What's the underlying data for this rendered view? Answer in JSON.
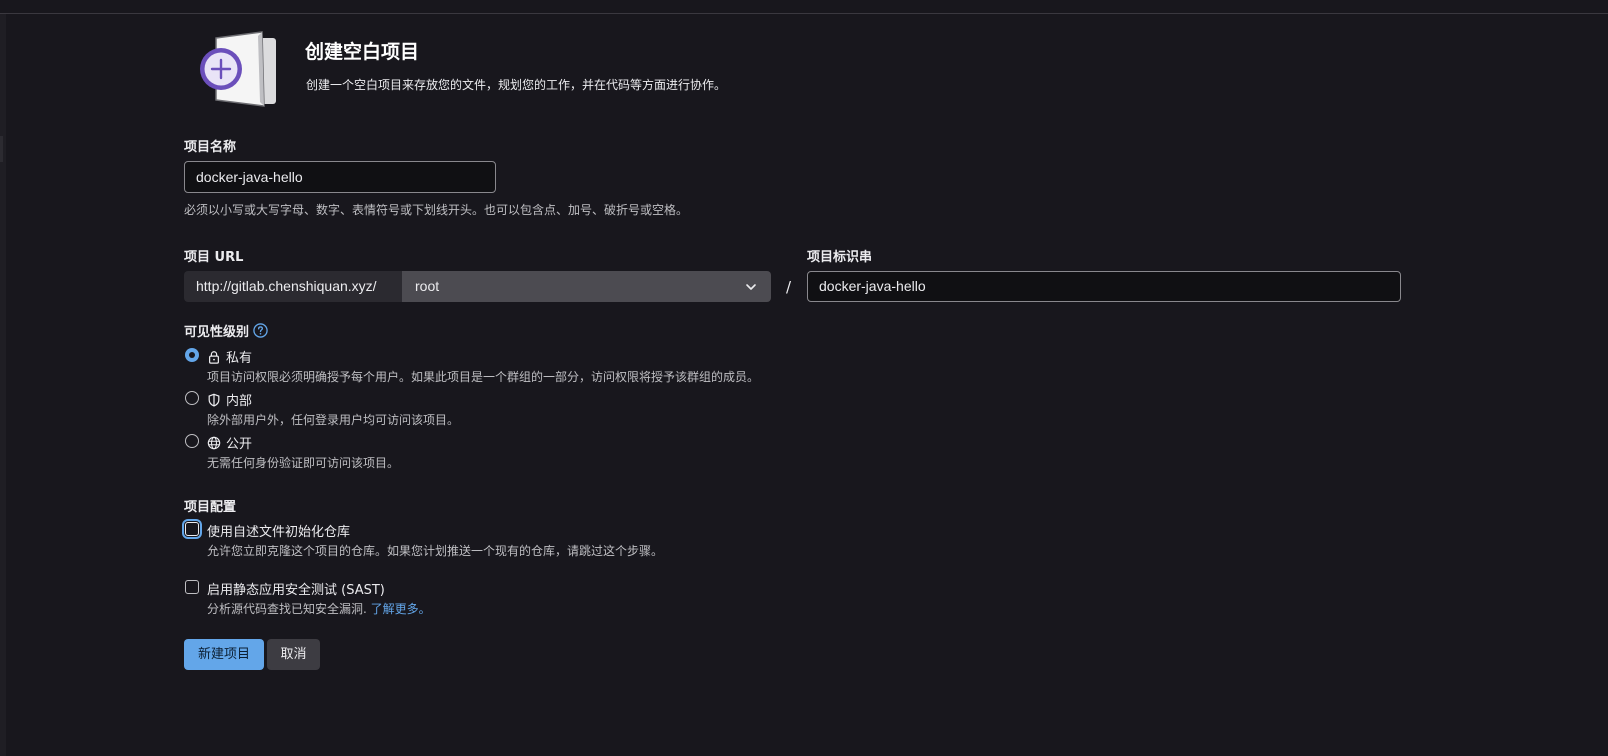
{
  "header": {
    "title": "创建空白项目",
    "subtitle": "创建一个空白项目来存放您的文件，规划您的工作，并在代码等方面进行协作。",
    "illustration_icon": "plus-document-icon"
  },
  "project_name": {
    "label": "项目名称",
    "value": "docker-java-hello",
    "help": "必须以小写或大写字母、数字、表情符号或下划线开头。也可以包含点、加号、破折号或空格。"
  },
  "project_url": {
    "label": "项目 URL",
    "prefix": "http://gitlab.chenshiquan.xyz/",
    "namespace": "root",
    "separator": "/"
  },
  "project_slug": {
    "label": "项目标识串",
    "value": "docker-java-hello"
  },
  "visibility": {
    "label": "可见性级别",
    "help_icon": "question-circle-icon",
    "options": [
      {
        "title": "私有",
        "icon": "lock-icon",
        "description": "项目访问权限必须明确授予每个用户。如果此项目是一个群组的一部分，访问权限将授予该群组的成员。",
        "checked": true
      },
      {
        "title": "内部",
        "icon": "shield-icon",
        "description": "除外部用户外，任何登录用户均可访问该项目。",
        "checked": false
      },
      {
        "title": "公开",
        "icon": "globe-icon",
        "description": "无需任何身份验证即可访问该项目。",
        "checked": false
      }
    ]
  },
  "config": {
    "label": "项目配置",
    "readme": {
      "label": "使用自述文件初始化仓库",
      "description": "允许您立即克隆这个项目的仓库。如果您计划推送一个现有的仓库，请跳过这个步骤。",
      "checked": false
    },
    "sast": {
      "label": "启用静态应用安全测试 (SAST)",
      "description": "分析源代码查找已知安全漏洞.",
      "link": "了解更多。",
      "checked": false
    }
  },
  "buttons": {
    "create": "新建项目",
    "cancel": "取消"
  },
  "colors": {
    "background": "#18171d",
    "accent": "#63a6e9",
    "illustration": "#6b4fbb"
  }
}
